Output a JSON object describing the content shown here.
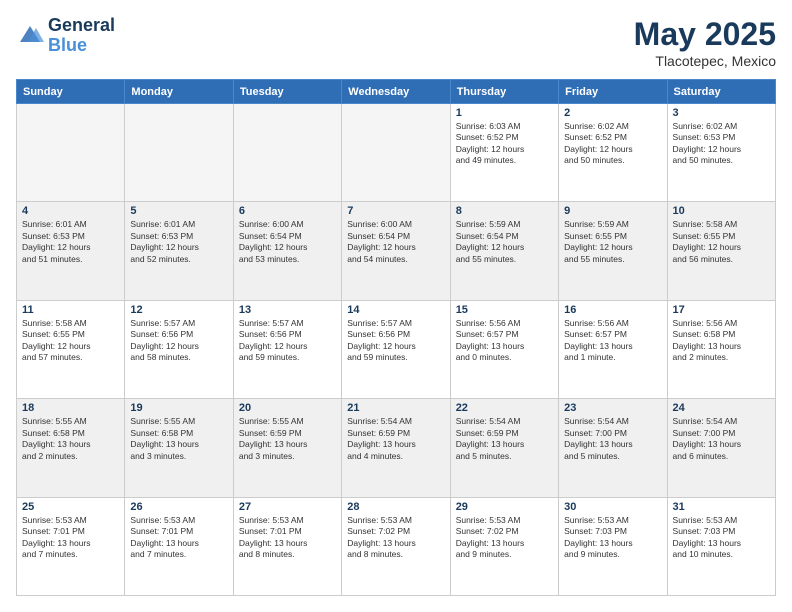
{
  "header": {
    "logo_line1": "General",
    "logo_line2": "Blue",
    "month": "May 2025",
    "location": "Tlacotepec, Mexico"
  },
  "weekdays": [
    "Sunday",
    "Monday",
    "Tuesday",
    "Wednesday",
    "Thursday",
    "Friday",
    "Saturday"
  ],
  "rows": [
    [
      {
        "day": "",
        "empty": true
      },
      {
        "day": "",
        "empty": true
      },
      {
        "day": "",
        "empty": true
      },
      {
        "day": "",
        "empty": true
      },
      {
        "day": "1",
        "lines": [
          "Sunrise: 6:03 AM",
          "Sunset: 6:52 PM",
          "Daylight: 12 hours",
          "and 49 minutes."
        ]
      },
      {
        "day": "2",
        "lines": [
          "Sunrise: 6:02 AM",
          "Sunset: 6:52 PM",
          "Daylight: 12 hours",
          "and 50 minutes."
        ]
      },
      {
        "day": "3",
        "lines": [
          "Sunrise: 6:02 AM",
          "Sunset: 6:53 PM",
          "Daylight: 12 hours",
          "and 50 minutes."
        ]
      }
    ],
    [
      {
        "day": "4",
        "lines": [
          "Sunrise: 6:01 AM",
          "Sunset: 6:53 PM",
          "Daylight: 12 hours",
          "and 51 minutes."
        ]
      },
      {
        "day": "5",
        "lines": [
          "Sunrise: 6:01 AM",
          "Sunset: 6:53 PM",
          "Daylight: 12 hours",
          "and 52 minutes."
        ]
      },
      {
        "day": "6",
        "lines": [
          "Sunrise: 6:00 AM",
          "Sunset: 6:54 PM",
          "Daylight: 12 hours",
          "and 53 minutes."
        ]
      },
      {
        "day": "7",
        "lines": [
          "Sunrise: 6:00 AM",
          "Sunset: 6:54 PM",
          "Daylight: 12 hours",
          "and 54 minutes."
        ]
      },
      {
        "day": "8",
        "lines": [
          "Sunrise: 5:59 AM",
          "Sunset: 6:54 PM",
          "Daylight: 12 hours",
          "and 55 minutes."
        ]
      },
      {
        "day": "9",
        "lines": [
          "Sunrise: 5:59 AM",
          "Sunset: 6:55 PM",
          "Daylight: 12 hours",
          "and 55 minutes."
        ]
      },
      {
        "day": "10",
        "lines": [
          "Sunrise: 5:58 AM",
          "Sunset: 6:55 PM",
          "Daylight: 12 hours",
          "and 56 minutes."
        ]
      }
    ],
    [
      {
        "day": "11",
        "lines": [
          "Sunrise: 5:58 AM",
          "Sunset: 6:55 PM",
          "Daylight: 12 hours",
          "and 57 minutes."
        ]
      },
      {
        "day": "12",
        "lines": [
          "Sunrise: 5:57 AM",
          "Sunset: 6:56 PM",
          "Daylight: 12 hours",
          "and 58 minutes."
        ]
      },
      {
        "day": "13",
        "lines": [
          "Sunrise: 5:57 AM",
          "Sunset: 6:56 PM",
          "Daylight: 12 hours",
          "and 59 minutes."
        ]
      },
      {
        "day": "14",
        "lines": [
          "Sunrise: 5:57 AM",
          "Sunset: 6:56 PM",
          "Daylight: 12 hours",
          "and 59 minutes."
        ]
      },
      {
        "day": "15",
        "lines": [
          "Sunrise: 5:56 AM",
          "Sunset: 6:57 PM",
          "Daylight: 13 hours",
          "and 0 minutes."
        ]
      },
      {
        "day": "16",
        "lines": [
          "Sunrise: 5:56 AM",
          "Sunset: 6:57 PM",
          "Daylight: 13 hours",
          "and 1 minute."
        ]
      },
      {
        "day": "17",
        "lines": [
          "Sunrise: 5:56 AM",
          "Sunset: 6:58 PM",
          "Daylight: 13 hours",
          "and 2 minutes."
        ]
      }
    ],
    [
      {
        "day": "18",
        "lines": [
          "Sunrise: 5:55 AM",
          "Sunset: 6:58 PM",
          "Daylight: 13 hours",
          "and 2 minutes."
        ]
      },
      {
        "day": "19",
        "lines": [
          "Sunrise: 5:55 AM",
          "Sunset: 6:58 PM",
          "Daylight: 13 hours",
          "and 3 minutes."
        ]
      },
      {
        "day": "20",
        "lines": [
          "Sunrise: 5:55 AM",
          "Sunset: 6:59 PM",
          "Daylight: 13 hours",
          "and 3 minutes."
        ]
      },
      {
        "day": "21",
        "lines": [
          "Sunrise: 5:54 AM",
          "Sunset: 6:59 PM",
          "Daylight: 13 hours",
          "and 4 minutes."
        ]
      },
      {
        "day": "22",
        "lines": [
          "Sunrise: 5:54 AM",
          "Sunset: 6:59 PM",
          "Daylight: 13 hours",
          "and 5 minutes."
        ]
      },
      {
        "day": "23",
        "lines": [
          "Sunrise: 5:54 AM",
          "Sunset: 7:00 PM",
          "Daylight: 13 hours",
          "and 5 minutes."
        ]
      },
      {
        "day": "24",
        "lines": [
          "Sunrise: 5:54 AM",
          "Sunset: 7:00 PM",
          "Daylight: 13 hours",
          "and 6 minutes."
        ]
      }
    ],
    [
      {
        "day": "25",
        "lines": [
          "Sunrise: 5:53 AM",
          "Sunset: 7:01 PM",
          "Daylight: 13 hours",
          "and 7 minutes."
        ]
      },
      {
        "day": "26",
        "lines": [
          "Sunrise: 5:53 AM",
          "Sunset: 7:01 PM",
          "Daylight: 13 hours",
          "and 7 minutes."
        ]
      },
      {
        "day": "27",
        "lines": [
          "Sunrise: 5:53 AM",
          "Sunset: 7:01 PM",
          "Daylight: 13 hours",
          "and 8 minutes."
        ]
      },
      {
        "day": "28",
        "lines": [
          "Sunrise: 5:53 AM",
          "Sunset: 7:02 PM",
          "Daylight: 13 hours",
          "and 8 minutes."
        ]
      },
      {
        "day": "29",
        "lines": [
          "Sunrise: 5:53 AM",
          "Sunset: 7:02 PM",
          "Daylight: 13 hours",
          "and 9 minutes."
        ]
      },
      {
        "day": "30",
        "lines": [
          "Sunrise: 5:53 AM",
          "Sunset: 7:03 PM",
          "Daylight: 13 hours",
          "and 9 minutes."
        ]
      },
      {
        "day": "31",
        "lines": [
          "Sunrise: 5:53 AM",
          "Sunset: 7:03 PM",
          "Daylight: 13 hours",
          "and 10 minutes."
        ]
      }
    ]
  ]
}
